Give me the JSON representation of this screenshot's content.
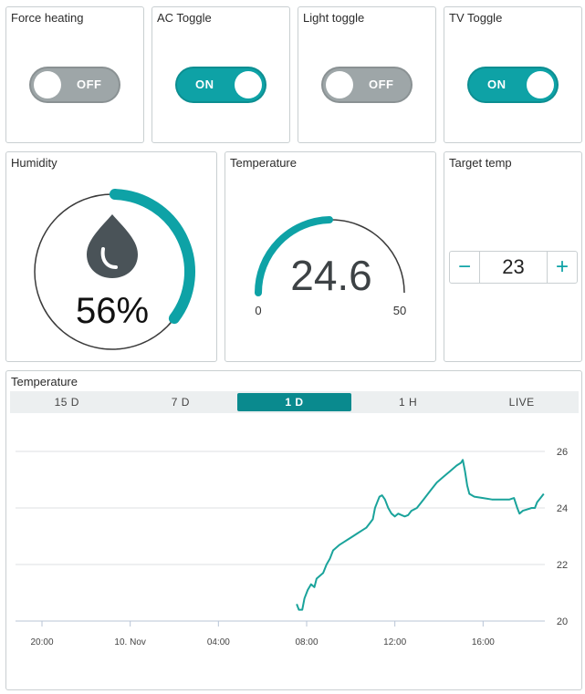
{
  "colors": {
    "accent": "#0ea2a6",
    "accent_dark": "#0a8a8e",
    "off": "#9ea6a8",
    "border": "#c9cfd1"
  },
  "toggles": [
    {
      "title": "Force heating",
      "state": "OFF"
    },
    {
      "title": "AC Toggle",
      "state": "ON"
    },
    {
      "title": "Light toggle",
      "state": "OFF"
    },
    {
      "title": "TV Toggle",
      "state": "ON"
    }
  ],
  "humidity": {
    "title": "Humidity",
    "value": 56,
    "display": "56%",
    "icon": "water-drop-icon"
  },
  "temperature_gauge": {
    "title": "Temperature",
    "value": 24.6,
    "display": "24.6",
    "min": 0,
    "max": 50,
    "min_label": "0",
    "max_label": "50"
  },
  "target_temp": {
    "title": "Target temp",
    "value": "23",
    "minus_label": "−",
    "plus_label": "+"
  },
  "chart_card": {
    "title": "Temperature",
    "tabs": [
      {
        "label": "15 D",
        "active": false
      },
      {
        "label": "7 D",
        "active": false
      },
      {
        "label": "1 D",
        "active": true
      },
      {
        "label": "1 H",
        "active": false
      },
      {
        "label": "LIVE",
        "active": false
      }
    ]
  },
  "chart_data": {
    "type": "line",
    "x_unit": "hours from 20:00 (9 Nov)",
    "x_ticks": [
      {
        "label": "20:00",
        "at": 0
      },
      {
        "label": "10. Nov",
        "at": 4
      },
      {
        "label": "04:00",
        "at": 8
      },
      {
        "label": "08:00",
        "at": 12
      },
      {
        "label": "12:00",
        "at": 16
      },
      {
        "label": "16:00",
        "at": 20
      }
    ],
    "y_ticks": [
      "20",
      "22",
      "24",
      "26"
    ],
    "ylim": [
      20,
      26
    ],
    "xlim": [
      -1.2,
      22.8
    ],
    "grid": true,
    "series": [
      {
        "color": "#1aa39b",
        "points": [
          [
            11.55,
            20.6
          ],
          [
            11.65,
            20.4
          ],
          [
            11.8,
            20.4
          ],
          [
            11.9,
            20.8
          ],
          [
            12.05,
            21.1
          ],
          [
            12.2,
            21.3
          ],
          [
            12.35,
            21.2
          ],
          [
            12.45,
            21.5
          ],
          [
            12.6,
            21.6
          ],
          [
            12.75,
            21.7
          ],
          [
            12.9,
            22.0
          ],
          [
            13.05,
            22.2
          ],
          [
            13.2,
            22.5
          ],
          [
            13.35,
            22.6
          ],
          [
            13.5,
            22.7
          ],
          [
            13.7,
            22.8
          ],
          [
            13.9,
            22.9
          ],
          [
            14.1,
            23.0
          ],
          [
            14.3,
            23.1
          ],
          [
            14.5,
            23.2
          ],
          [
            14.7,
            23.3
          ],
          [
            14.85,
            23.45
          ],
          [
            15.0,
            23.6
          ],
          [
            15.1,
            24.0
          ],
          [
            15.2,
            24.2
          ],
          [
            15.3,
            24.4
          ],
          [
            15.42,
            24.45
          ],
          [
            15.55,
            24.3
          ],
          [
            15.7,
            24.0
          ],
          [
            15.85,
            23.8
          ],
          [
            16.0,
            23.7
          ],
          [
            16.15,
            23.8
          ],
          [
            16.3,
            23.75
          ],
          [
            16.45,
            23.7
          ],
          [
            16.6,
            23.75
          ],
          [
            16.75,
            23.9
          ],
          [
            17.0,
            24.0
          ],
          [
            17.3,
            24.3
          ],
          [
            17.6,
            24.6
          ],
          [
            17.9,
            24.9
          ],
          [
            18.2,
            25.1
          ],
          [
            18.5,
            25.3
          ],
          [
            18.8,
            25.5
          ],
          [
            19.0,
            25.6
          ],
          [
            19.08,
            25.7
          ],
          [
            19.18,
            25.3
          ],
          [
            19.28,
            24.8
          ],
          [
            19.38,
            24.5
          ],
          [
            19.6,
            24.4
          ],
          [
            20.0,
            24.35
          ],
          [
            20.4,
            24.3
          ],
          [
            20.8,
            24.3
          ],
          [
            21.2,
            24.3
          ],
          [
            21.4,
            24.35
          ],
          [
            21.55,
            24.0
          ],
          [
            21.65,
            23.8
          ],
          [
            21.8,
            23.9
          ],
          [
            22.0,
            23.95
          ],
          [
            22.2,
            24.0
          ],
          [
            22.35,
            24.0
          ],
          [
            22.45,
            24.2
          ],
          [
            22.6,
            24.35
          ],
          [
            22.75,
            24.5
          ]
        ]
      }
    ]
  }
}
